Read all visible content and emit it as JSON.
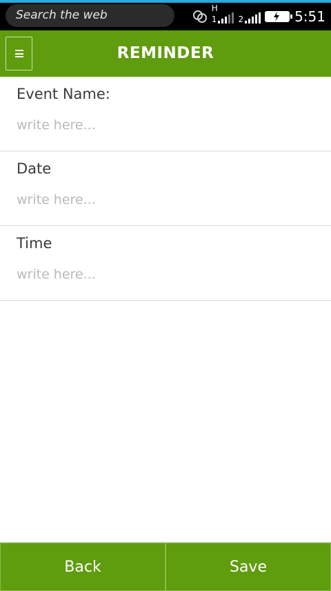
{
  "status_bar": {
    "search_text": "Search the web",
    "sim1_label": "1",
    "sim1_network": "H",
    "sim2_label": "2",
    "time": "5:51",
    "icons": [
      "link-icon",
      "signal-icon",
      "signal-icon",
      "battery-charging-icon"
    ]
  },
  "header": {
    "menu_icon": "menu-icon",
    "title": "REMINDER"
  },
  "form": {
    "fields": [
      {
        "label": "Event Name:",
        "placeholder": "write here..."
      },
      {
        "label": "Date",
        "placeholder": "write here..."
      },
      {
        "label": "Time",
        "placeholder": "write here..."
      }
    ]
  },
  "footer": {
    "back_label": "Back",
    "save_label": "Save"
  },
  "colors": {
    "accent": "#5f9c0e",
    "status_bar": "#000000",
    "status_bar_top_line": "#2aa8e0"
  }
}
